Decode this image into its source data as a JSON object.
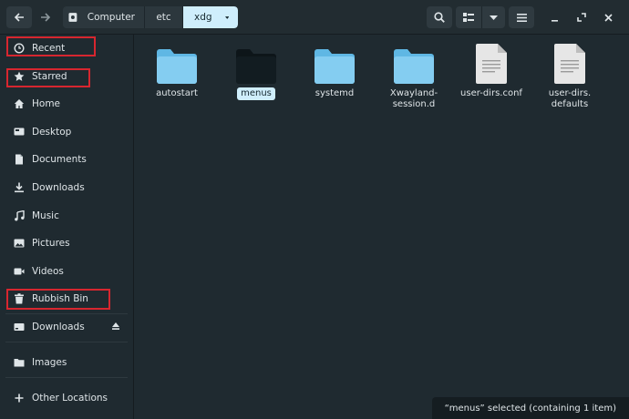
{
  "header": {
    "back_icon": "arrow-left-icon",
    "forward_icon": "arrow-right-icon",
    "path": [
      {
        "label": "Computer",
        "icon": "drive-icon"
      },
      {
        "label": "etc"
      },
      {
        "label": "xdg",
        "active": true
      }
    ],
    "buttons": [
      "search-icon",
      "view-grid-icon",
      "chevron-down-icon",
      "hamburger-menu-icon"
    ],
    "window_controls": [
      "minimize-icon",
      "maximize-icon",
      "close-icon"
    ]
  },
  "sidebar": {
    "items": [
      {
        "label": "Recent",
        "icon": "clock-icon",
        "highlighted": true
      },
      {
        "label": "Starred",
        "icon": "star-icon",
        "highlighted": true
      },
      {
        "label": "Home",
        "icon": "home-icon"
      },
      {
        "label": "Desktop",
        "icon": "desktop-icon"
      },
      {
        "label": "Documents",
        "icon": "document-icon"
      },
      {
        "label": "Downloads",
        "icon": "download-icon"
      },
      {
        "label": "Music",
        "icon": "music-icon"
      },
      {
        "label": "Pictures",
        "icon": "picture-icon"
      },
      {
        "label": "Videos",
        "icon": "video-icon"
      },
      {
        "label": "Rubbish Bin",
        "icon": "trash-icon",
        "highlighted": true
      },
      {
        "label": "Downloads",
        "icon": "drive-icon",
        "eject": true
      },
      {
        "label": "Images",
        "icon": "folder-icon"
      },
      {
        "label": "Other Locations",
        "icon": "plus-icon"
      }
    ]
  },
  "files": [
    {
      "label": "autostart",
      "type": "folder"
    },
    {
      "label": "menus",
      "type": "folder-open",
      "selected": true
    },
    {
      "label": "systemd",
      "type": "folder"
    },
    {
      "label": "Xwayland-\nsession.d",
      "type": "folder"
    },
    {
      "label": "user-dirs.conf",
      "type": "text-file"
    },
    {
      "label": "user-dirs.\ndefaults",
      "type": "text-file"
    }
  ],
  "status": {
    "text": "“menus” selected  (containing 1 item)"
  },
  "colors": {
    "background": "#1f2a30",
    "folder": "#7cc8ee",
    "selection": "#cfeefc",
    "highlight_box": "#d7262f"
  }
}
